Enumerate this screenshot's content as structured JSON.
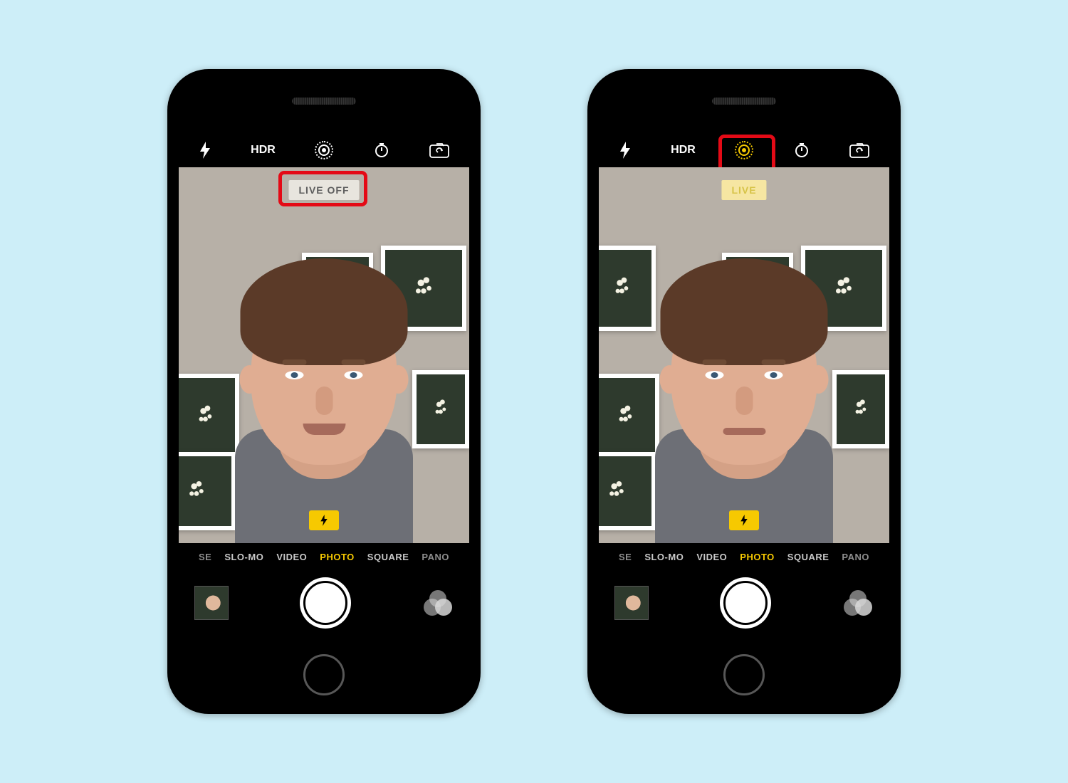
{
  "topbar": {
    "hdr_label": "HDR"
  },
  "live": {
    "off_label": "LIVE OFF",
    "on_label": "LIVE"
  },
  "modes": {
    "partial_lapse": "SE",
    "slomo": "SLO-MO",
    "video": "VIDEO",
    "photo": "PHOTO",
    "square": "SQUARE",
    "pano": "PANO"
  },
  "colors": {
    "accent_yellow": "#f6c901",
    "highlight_red": "#e40a16"
  }
}
